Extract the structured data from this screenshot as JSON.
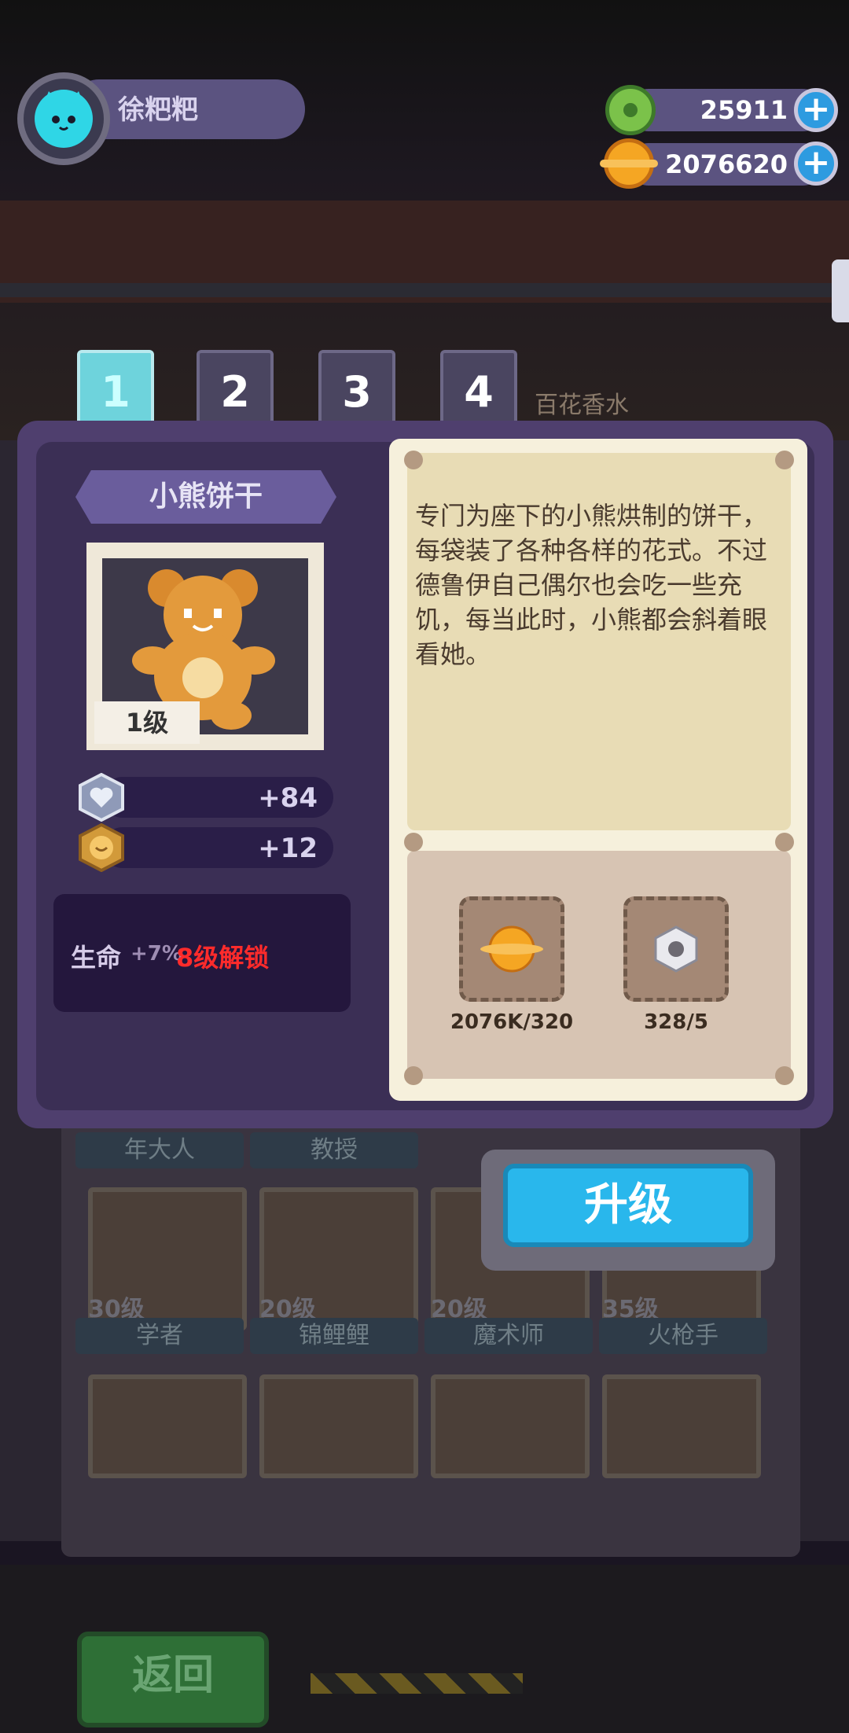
{
  "player": {
    "name": "徐粑粑"
  },
  "currencies": [
    {
      "icon": "donut-icon",
      "value": "25911",
      "color": "#7bc24a"
    },
    {
      "icon": "coin-icon",
      "value": "2076620",
      "color": "#f5a623"
    }
  ],
  "tabs": [
    {
      "label": "1",
      "active": true
    },
    {
      "label": "2",
      "active": false
    },
    {
      "label": "3",
      "active": false
    },
    {
      "label": "4",
      "active": false
    }
  ],
  "background": {
    "shop_sign": "百花香水",
    "row1": [
      "年大人",
      "教授",
      "",
      ""
    ],
    "row2": [
      {
        "level": "30级",
        "name": "学者"
      },
      {
        "level": "20级",
        "name": "锦鲤鲤"
      },
      {
        "level": "20级",
        "name": "魔术师"
      },
      {
        "level": "35级",
        "name": "火枪手"
      }
    ],
    "back_button": "返回"
  },
  "item": {
    "name": "小熊饼干",
    "level": "1级",
    "stats": [
      {
        "icon": "heart-shield-icon",
        "value": "+84"
      },
      {
        "icon": "smile-badge-icon",
        "value": "+12"
      }
    ],
    "locked_bonus": {
      "label": "生命",
      "percent": "+7%",
      "unlock": "8级解锁"
    },
    "description": "专门为座下的小熊烘制的饼干，每袋装了各种各样的花式。不过德鲁伊自己偶尔也会吃一些充饥，每当此时，小熊都会斜着眼看她。",
    "costs": [
      {
        "icon": "coin-icon",
        "value": "2076K/320"
      },
      {
        "icon": "nut-icon",
        "value": "328/5"
      }
    ]
  },
  "upgrade_button": "升级"
}
